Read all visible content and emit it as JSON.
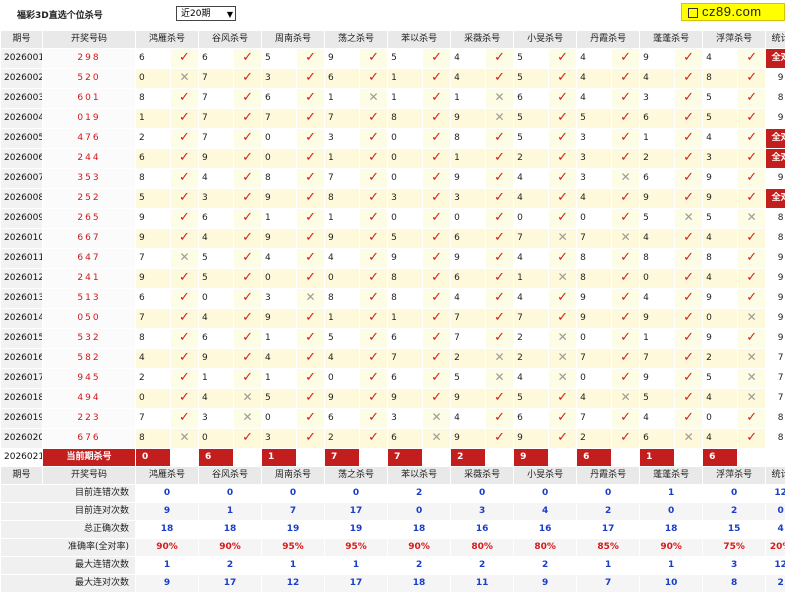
{
  "header": {
    "title": "福彩3D直选个位杀号",
    "period_select": "近20期",
    "logo_text": "cz89.com"
  },
  "columns": {
    "period": "期号",
    "numbers": "开奖号码",
    "stat": "统计",
    "methods": [
      "鸿雁杀号",
      "谷风杀号",
      "周南杀号",
      "荡之杀号",
      "苯以杀号",
      "采薇杀号",
      "小旻杀号",
      "丹霞杀号",
      "蓬蓬杀号",
      "浮萍杀号"
    ]
  },
  "rows": [
    {
      "period": "2026001",
      "nums": "298",
      "preds": [
        "6",
        "6",
        "5",
        "9",
        "5",
        "4",
        "5",
        "4",
        "9",
        "4"
      ],
      "marks": "YYYYYYYYYY",
      "stat": "全对"
    },
    {
      "period": "2026002",
      "nums": "520",
      "preds": [
        "0",
        "7",
        "3",
        "6",
        "1",
        "4",
        "5",
        "4",
        "4",
        "8"
      ],
      "marks": "NYYYYYYYYY",
      "stat": "9"
    },
    {
      "period": "2026003",
      "nums": "601",
      "preds": [
        "8",
        "7",
        "6",
        "1",
        "1",
        "1",
        "6",
        "4",
        "3",
        "5"
      ],
      "marks": "YYYNYNYYYY",
      "stat": "8"
    },
    {
      "period": "2026004",
      "nums": "019",
      "preds": [
        "1",
        "7",
        "7",
        "7",
        "8",
        "9",
        "5",
        "5",
        "6",
        "5"
      ],
      "marks": "YYYYYNYYYY",
      "stat": "9"
    },
    {
      "period": "2026005",
      "nums": "476",
      "preds": [
        "2",
        "7",
        "0",
        "3",
        "0",
        "8",
        "5",
        "3",
        "1",
        "4"
      ],
      "marks": "YYYYYYYYYY",
      "stat": "全对"
    },
    {
      "period": "2026006",
      "nums": "244",
      "preds": [
        "6",
        "9",
        "0",
        "1",
        "0",
        "1",
        "2",
        "3",
        "2",
        "3"
      ],
      "marks": "YYYYYYYYYY",
      "stat": "全对"
    },
    {
      "period": "2026007",
      "nums": "353",
      "preds": [
        "8",
        "4",
        "8",
        "7",
        "0",
        "9",
        "4",
        "3",
        "6",
        "9"
      ],
      "marks": "YYYYYYYNYY",
      "stat": "9"
    },
    {
      "period": "2026008",
      "nums": "252",
      "preds": [
        "5",
        "3",
        "9",
        "8",
        "3",
        "3",
        "4",
        "4",
        "9",
        "9"
      ],
      "marks": "YYYYYYYYYY",
      "stat": "全对"
    },
    {
      "period": "2026009",
      "nums": "265",
      "preds": [
        "9",
        "6",
        "1",
        "1",
        "0",
        "0",
        "0",
        "0",
        "5",
        "5"
      ],
      "marks": "YYYYYYYYNN",
      "stat": "8"
    },
    {
      "period": "2026010",
      "nums": "667",
      "preds": [
        "9",
        "4",
        "9",
        "9",
        "5",
        "6",
        "7",
        "7",
        "4",
        "4"
      ],
      "marks": "YYYYYYNNYY",
      "stat": "8"
    },
    {
      "period": "2026011",
      "nums": "647",
      "preds": [
        "7",
        "5",
        "4",
        "4",
        "9",
        "9",
        "4",
        "8",
        "8",
        "8"
      ],
      "marks": "NYYYYYYYYY",
      "stat": "9"
    },
    {
      "period": "2026012",
      "nums": "241",
      "preds": [
        "9",
        "5",
        "0",
        "0",
        "8",
        "6",
        "1",
        "8",
        "0",
        "4"
      ],
      "marks": "YYYYYYNYYY",
      "stat": "9"
    },
    {
      "period": "2026013",
      "nums": "513",
      "preds": [
        "6",
        "0",
        "3",
        "8",
        "8",
        "4",
        "4",
        "9",
        "4",
        "9"
      ],
      "marks": "YYNYYYYYYY",
      "stat": "9"
    },
    {
      "period": "2026014",
      "nums": "050",
      "preds": [
        "7",
        "4",
        "9",
        "1",
        "1",
        "7",
        "7",
        "9",
        "9",
        "0"
      ],
      "marks": "YYYYYYYYYN",
      "stat": "9"
    },
    {
      "period": "2026015",
      "nums": "532",
      "preds": [
        "8",
        "6",
        "1",
        "5",
        "6",
        "7",
        "2",
        "0",
        "1",
        "9"
      ],
      "marks": "YYYYYYNYYY",
      "stat": "9"
    },
    {
      "period": "2026016",
      "nums": "582",
      "preds": [
        "4",
        "9",
        "4",
        "4",
        "7",
        "2",
        "2",
        "7",
        "7",
        "2"
      ],
      "marks": "YYYYYNNYYN",
      "stat": "7"
    },
    {
      "period": "2026017",
      "nums": "945",
      "preds": [
        "2",
        "1",
        "1",
        "0",
        "6",
        "5",
        "4",
        "0",
        "9",
        "5"
      ],
      "marks": "YYYYYNNYYN",
      "stat": "7"
    },
    {
      "period": "2026018",
      "nums": "494",
      "preds": [
        "0",
        "4",
        "5",
        "9",
        "9",
        "9",
        "5",
        "4",
        "5",
        "4"
      ],
      "marks": "YNYYYYYNYN",
      "stat": "7"
    },
    {
      "period": "2026019",
      "nums": "223",
      "preds": [
        "7",
        "3",
        "0",
        "6",
        "3",
        "4",
        "6",
        "7",
        "4",
        "0"
      ],
      "marks": "YNYYNYYYYY",
      "stat": "8"
    },
    {
      "period": "2026020",
      "nums": "676",
      "preds": [
        "8",
        "0",
        "3",
        "2",
        "6",
        "9",
        "9",
        "2",
        "6",
        "4"
      ],
      "marks": "NYYYNYYYNY",
      "stat": "8"
    }
  ],
  "current": {
    "period": "2026021",
    "label": "当前期杀号",
    "preds": [
      "0",
      "6",
      "1",
      "7",
      "7",
      "2",
      "9",
      "6",
      "1",
      "6"
    ]
  },
  "stats": [
    {
      "label": "目前连错次数",
      "values": [
        "0",
        "0",
        "0",
        "0",
        "2",
        "0",
        "0",
        "0",
        "1",
        "0",
        "12"
      ]
    },
    {
      "label": "目前连对次数",
      "values": [
        "9",
        "1",
        "7",
        "17",
        "0",
        "3",
        "4",
        "2",
        "0",
        "2",
        "0"
      ]
    },
    {
      "label": "总正确次数",
      "values": [
        "18",
        "18",
        "19",
        "19",
        "18",
        "16",
        "16",
        "17",
        "18",
        "15",
        "4"
      ]
    },
    {
      "label": "准确率(全对率)",
      "values": [
        "90%",
        "90%",
        "95%",
        "95%",
        "90%",
        "80%",
        "80%",
        "85%",
        "90%",
        "75%",
        "20%"
      ],
      "rate": true
    },
    {
      "label": "最大连错次数",
      "values": [
        "1",
        "2",
        "1",
        "1",
        "2",
        "2",
        "2",
        "1",
        "1",
        "3",
        "12"
      ]
    },
    {
      "label": "最大连对次数",
      "values": [
        "9",
        "17",
        "12",
        "17",
        "18",
        "11",
        "9",
        "7",
        "10",
        "8",
        "2"
      ]
    }
  ]
}
